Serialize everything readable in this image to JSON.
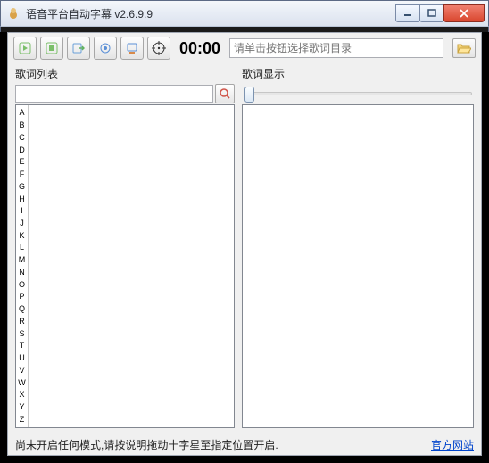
{
  "title": "语音平台自动字幕 v2.6.9.9",
  "timer": "00:00",
  "path_placeholder": "请单击按钮选择歌词目录",
  "left": {
    "label": "歌词列表"
  },
  "right": {
    "label": "歌词显示"
  },
  "alphabet": [
    "A",
    "B",
    "C",
    "D",
    "E",
    "F",
    "G",
    "H",
    "I",
    "J",
    "K",
    "L",
    "M",
    "N",
    "O",
    "P",
    "Q",
    "R",
    "S",
    "T",
    "U",
    "V",
    "W",
    "X",
    "Y",
    "Z"
  ],
  "status": {
    "text": "尚未开启任何模式,请按说明拖动十字星至指定位置开启.",
    "link": "官方网站"
  },
  "icons": {
    "tool1": "play-icon",
    "tool2": "stop-icon",
    "tool3": "send-icon",
    "tool4": "settings-icon",
    "tool5": "device-icon",
    "tool6": "target-icon",
    "browse": "folder-open-icon",
    "search": "search-icon"
  }
}
